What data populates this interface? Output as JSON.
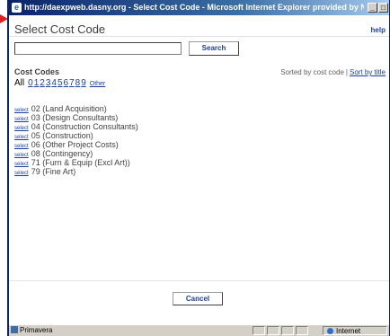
{
  "window": {
    "title": "http://daexpweb.dasny.org - Select Cost Code - Microsoft Internet Explorer provided by NYS Dormatory Au...",
    "minimize_glyph": "_",
    "maximize_glyph": "□"
  },
  "header": {
    "title": "Select Cost Code",
    "help_label": "help"
  },
  "search": {
    "value": "",
    "placeholder": "",
    "button_label": "Search"
  },
  "codes": {
    "section_label": "Cost Codes",
    "sort_text": "Sorted by cost code",
    "sort_separator": "|",
    "sort_by_title_label": "Sort by title",
    "filter_all_label": "All",
    "filter_digits": [
      "0",
      "1",
      "2",
      "3",
      "4",
      "5",
      "6",
      "7",
      "8",
      "9"
    ],
    "filter_other_label": "Other",
    "select_label": "select",
    "items": [
      "02 (Land Acquisition)",
      "03 (Design Consultants)",
      "04 (Construction Consultants)",
      "05 (Construction)",
      "06 (Other Project Costs)",
      "08 (Contingency)",
      "71 (Furn & Equip (Excl Art))",
      "79 (Fine Art)"
    ]
  },
  "footer": {
    "cancel_label": "Cancel"
  },
  "statusbar": {
    "left_text": "Primavera",
    "zone_text": "Internet"
  },
  "colors": {
    "link": "#1a3fa0",
    "titlebar": "#0a246a",
    "annotation_pointer": "#e02020"
  }
}
